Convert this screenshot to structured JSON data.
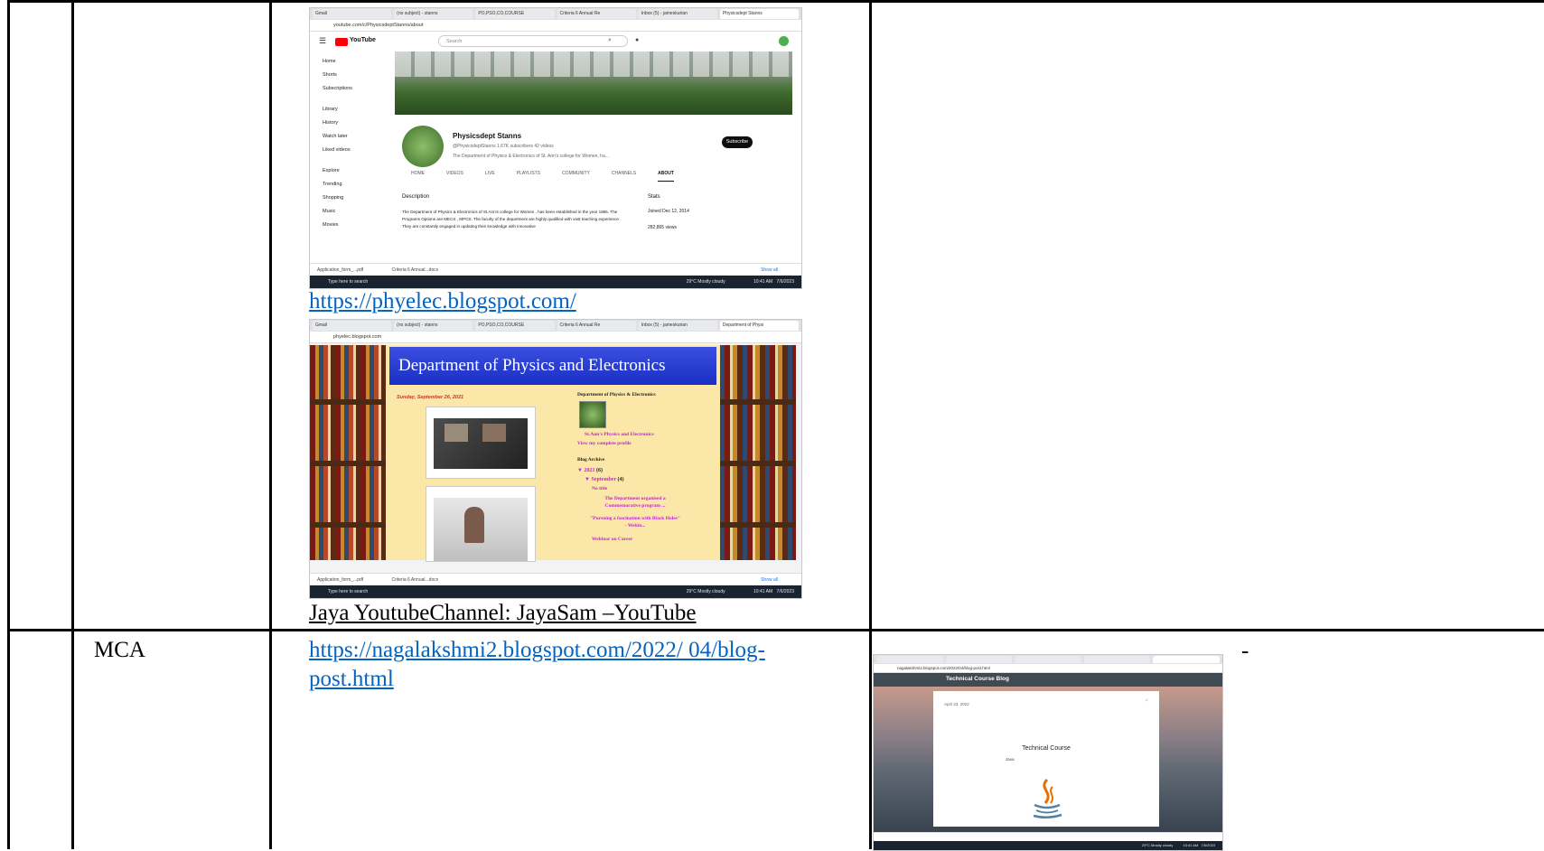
{
  "row1": {
    "youtube_screenshot": {
      "tabs": [
        "Gmail",
        "(no subject) - stanns",
        "PO,PSO,CO,COURSE",
        "Criteria 6 Annual Re",
        "Inbox (5) - jameskurian",
        "Physicsdept Stanns"
      ],
      "url": "youtube.com/c/PhysicsdeptStanns/about",
      "search_placeholder": "Search",
      "sidebar": [
        "Home",
        "Shorts",
        "Subscriptions",
        "Library",
        "History",
        "Watch later",
        "Liked videos",
        "Explore",
        "Trending",
        "Shopping",
        "Music",
        "Movies"
      ],
      "channel_name": "Physicsdept Stanns",
      "channel_handle": "@PhysicsdeptStanns  1.67K subscribers  42 videos",
      "channel_about": "The Department of Physics & Electronics of St. Ann's college for Women, ha...",
      "subscribe": "Subscribe",
      "channel_tabs": [
        "HOME",
        "VIDEOS",
        "LIVE",
        "PLAYLISTS",
        "COMMUNITY",
        "CHANNELS",
        "ABOUT"
      ],
      "description_heading": "Description",
      "description_text": "The Department of Physics & Electronics of St.Ann's college for Women , has been established in the year 1985. The Programs Options are MECS , MPCS. The faculty of the department are highly qualified with vast teaching experience . They are constantly engaged in updating  their knowledge with innovative",
      "stats_heading": "Stats",
      "joined": "Joined Dec 12, 2014",
      "views": "282,865 views",
      "download_items": [
        "Application_form_...pdf",
        "Criteria 6 Annual...docx"
      ],
      "show_all": "Show all",
      "taskbar_search": "Type here to search",
      "weather": "29°C  Mostly cloudy",
      "clock_time": "10:41 AM",
      "clock_date": "7/6/2023"
    },
    "blog_link": "https://phyelec.blogspot.com/",
    "blog_screenshot": {
      "tabs": [
        "Gmail",
        "(no subject) - stanns",
        "PO,PSO,CO,COURSE",
        "Criteria 6 Annual Re",
        "Inbox (5) - jameskurian",
        "Department of Physi"
      ],
      "url": "phyelec.blogspot.com",
      "header_title": "Department of Physics and Electronics",
      "post_date": "Sunday, September 26, 2021",
      "side_heading": "Department of Physics & Electronics",
      "profile_name": "St.Ann's Physics and Electronics",
      "profile_link": "View my complete profile",
      "archive_heading": "Blog Archive",
      "archive_year": "2021",
      "archive_year_count": "(6)",
      "archive_month": "September",
      "archive_month_count": "(4)",
      "archive_posts": [
        "No title",
        "The Department organised a Commemorative program ...",
        "\"Pursuing a fascination with Black Holes\" - Webin...",
        "Webinar on Career"
      ],
      "download_items": [
        "Application_form_...pdf",
        "Criteria 6 Annual...docx"
      ],
      "show_all": "Show all",
      "taskbar_search": "Type here to search",
      "weather": "29°C  Mostly cloudy",
      "clock_time": "10:41 AM",
      "clock_date": "7/6/2023"
    },
    "channel_caption": "Jaya YoutubeChannel: JayaSam –YouTube"
  },
  "row2": {
    "program": "MCA",
    "link_line1": "https://nagalakshmi2.blogspot.com/2022/ 04/blog-",
    "link_line2": "post.html",
    "dash": "-",
    "screenshot": {
      "url": "nagalakshmi2.blogspot.com/2022/04/blog-post.html",
      "blog_title": "Technical Course Blog",
      "date": "April 23, 2022",
      "post_title": "Technical Course",
      "post_sub": "Java",
      "weather": "29°C  Mostly cloudy",
      "clock_time": "10:41 AM",
      "clock_date": "7/6/2023"
    }
  }
}
